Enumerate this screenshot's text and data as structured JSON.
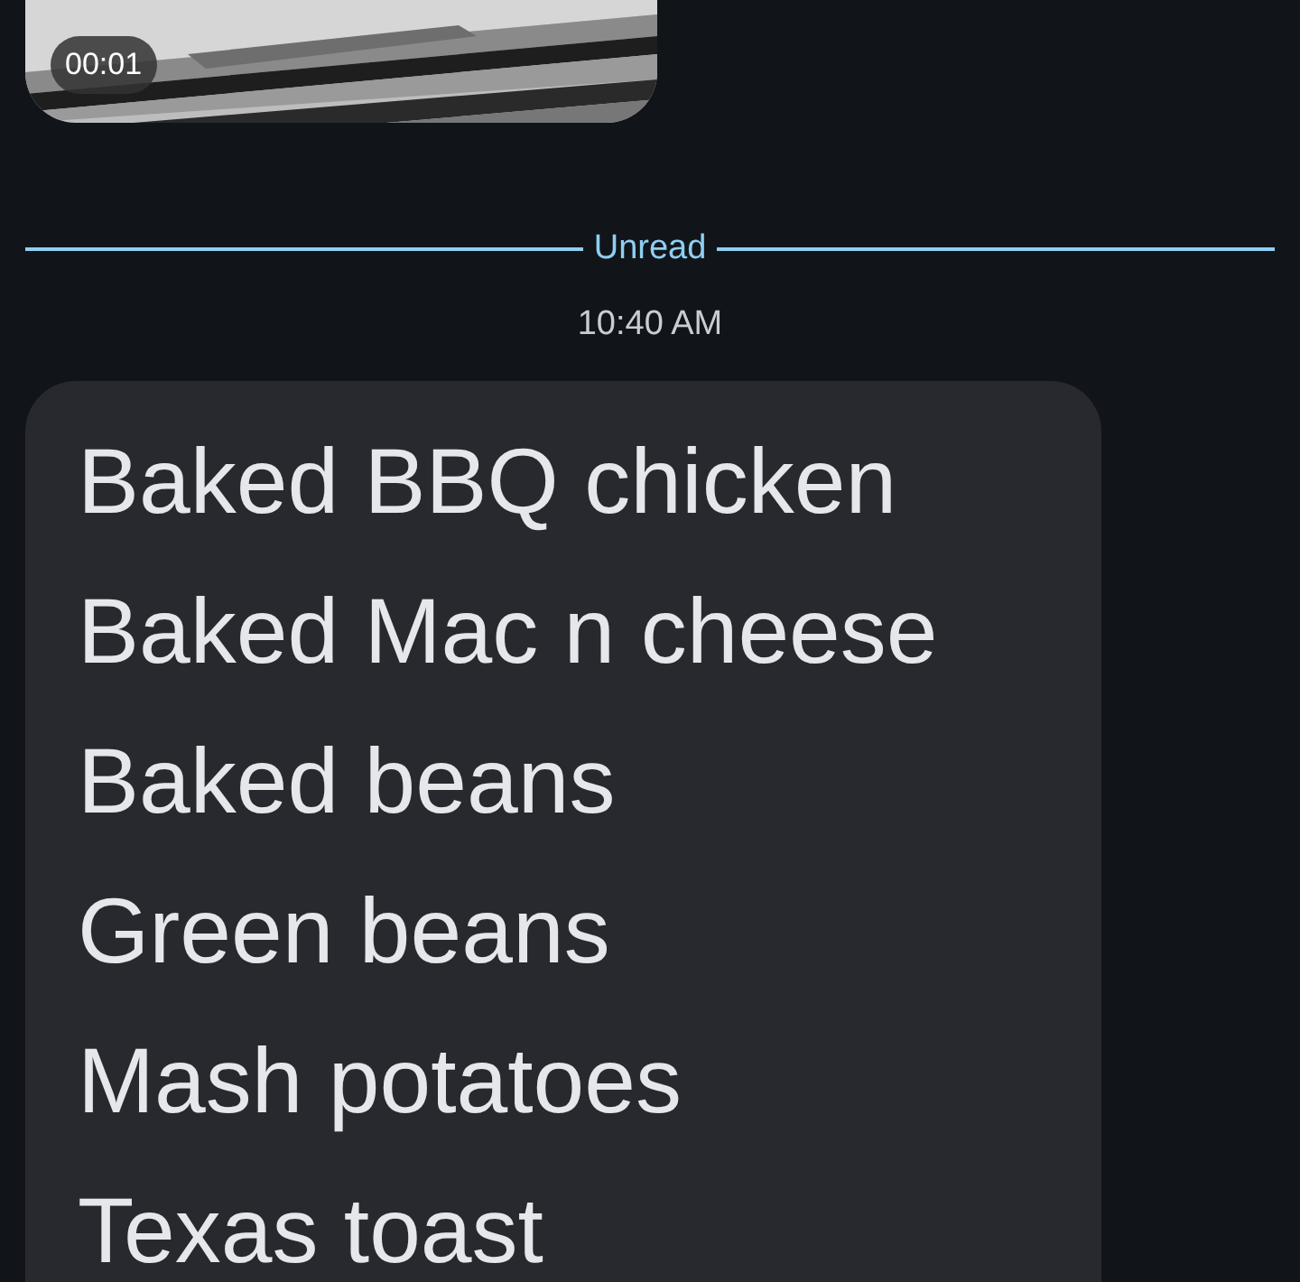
{
  "video": {
    "kind": "picture",
    "duration": "00:01"
  },
  "divider": {
    "label": "Unread"
  },
  "timestamp": "10:40 AM",
  "message": {
    "lines": [
      "Baked BBQ chicken",
      "Baked Mac n cheese",
      "Baked beans",
      "Green beans",
      "Mash potatoes",
      "Texas toast"
    ]
  }
}
